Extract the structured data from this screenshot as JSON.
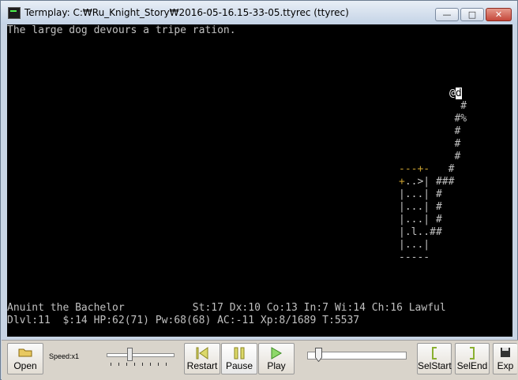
{
  "window": {
    "title": "Termplay: C:₩Ru_Knight_Story₩2016-05-16.15-33-05.ttyrec (ttyrec)",
    "min_glyph": "—",
    "max_glyph": "□",
    "close_glyph": "✕"
  },
  "terminal": {
    "message": "The large dog devours a tripe ration.",
    "status_line1": "Anuint the Bachelor           St:17 Dx:10 Co:13 In:7 Wi:14 Ch:16 Lawful",
    "status_line2": "Dlvl:11  $:14 HP:62(71) Pw:68(68) AC:-11 Xp:8/1689 T:5537",
    "map": {
      "row1_pad": "          ",
      "player": "@",
      "dog": "d",
      "row2": "          #",
      "row3_a": "         #",
      "row3_b": "%",
      "row4": "         #",
      "row5": "         #",
      "row6": "         #",
      "row7_a": "---+-",
      "row7_b": "   #",
      "row8_a": "+",
      "row8_b": "..>| ###",
      "row9": "|...| #",
      "row10": "|...| #",
      "row11": "|...| #",
      "row12": "|.l..##",
      "row13": "|...|",
      "row14": "-----"
    }
  },
  "toolbar": {
    "open_label": "Open",
    "speed_label": "Speed:x1",
    "speed_value": 0.35,
    "restart_label": "Restart",
    "pause_label": "Pause",
    "play_label": "Play",
    "position_value": 0.05,
    "selstart_label": "SelStart",
    "selend_label": "SelEnd",
    "export_label": "Exp"
  }
}
